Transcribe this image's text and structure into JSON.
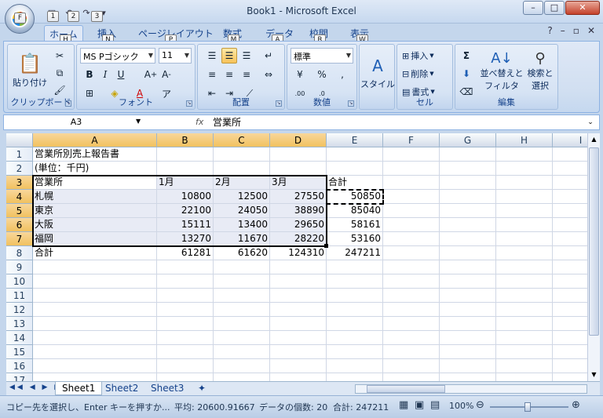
{
  "window": {
    "title": "Book1 - Microsoft Excel"
  },
  "office_button": {
    "keytip": "F"
  },
  "qat": {
    "keytips": [
      "1",
      "2",
      "3"
    ]
  },
  "tabs": [
    {
      "label": "ホーム",
      "keytip": "H"
    },
    {
      "label": "挿入",
      "keytip": "N"
    },
    {
      "label": "ページレイアウト",
      "keytip": "P"
    },
    {
      "label": "数式",
      "keytip": "M"
    },
    {
      "label": "データ",
      "keytip": "A"
    },
    {
      "label": "校閲",
      "keytip": "R"
    },
    {
      "label": "表示",
      "keytip": "W"
    }
  ],
  "ribbon": {
    "clipboard": {
      "label": "クリップボード",
      "paste_label": "貼り付け"
    },
    "font": {
      "label": "フォント",
      "font_name": "MS Pゴシック",
      "font_size": "11"
    },
    "alignment": {
      "label": "配置"
    },
    "number": {
      "label": "数値",
      "format": "標準"
    },
    "style": {
      "label": "スタイル"
    },
    "cells": {
      "label": "セル",
      "insert": "挿入",
      "delete": "削除",
      "format": "書式"
    },
    "editing": {
      "label": "編集",
      "sort": "並べ替えと",
      "sort2": "フィルタ",
      "find": "検索と",
      "find2": "選択"
    }
  },
  "formula_bar": {
    "name_box": "A3",
    "fx": "fx",
    "content": "営業所"
  },
  "columns": [
    "A",
    "B",
    "C",
    "D",
    "E",
    "F",
    "G",
    "H",
    "I"
  ],
  "rows": [
    "1",
    "2",
    "3",
    "4",
    "5",
    "6",
    "7",
    "8",
    "9",
    "10",
    "11",
    "12",
    "13",
    "14",
    "15",
    "16",
    "17"
  ],
  "cells": {
    "a1": "営業所別売上報告書",
    "a2": "(単位：千円)",
    "r3": [
      "営業所",
      "1月",
      "2月",
      "3月",
      "合計"
    ],
    "r4": [
      "札幌",
      "10800",
      "12500",
      "27550",
      "50850"
    ],
    "r5": [
      "東京",
      "22100",
      "24050",
      "38890",
      "85040"
    ],
    "r6": [
      "大阪",
      "15111",
      "13400",
      "29650",
      "58161"
    ],
    "r7": [
      "福岡",
      "13270",
      "11670",
      "28220",
      "53160"
    ],
    "r8": [
      "合計",
      "61281",
      "61620",
      "124310",
      "247211"
    ]
  },
  "sheet_tabs": [
    "Sheet1",
    "Sheet2",
    "Sheet3"
  ],
  "status": {
    "message": "コピー先を選択し、Enter キーを押すか...",
    "average": "平均: 20600.91667",
    "count": "データの個数: 20",
    "sum": "合計: 247211",
    "zoom": "100%"
  }
}
